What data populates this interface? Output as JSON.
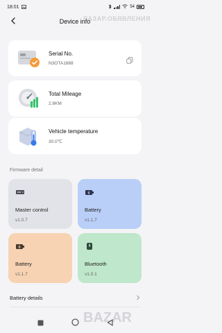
{
  "status_bar": {
    "time": "18:01",
    "battery_percent": "54"
  },
  "header": {
    "title": "Device info",
    "watermark": "ВАЗАР.ОБЯВЛЕНИЯ"
  },
  "info_cards": [
    {
      "label": "Serial No.",
      "value": "N3OTA1888",
      "icon": "scooter-serial-icon"
    },
    {
      "label": "Total Mileage",
      "value": "2.8KM",
      "icon": "speedometer-icon"
    },
    {
      "label": "Vehicle temperature",
      "value": "30.0℃",
      "icon": "thermometer-icon"
    }
  ],
  "firmware": {
    "section_title": "Firmware detail",
    "tiles": [
      {
        "name": "Master control",
        "version": "v1.0.7",
        "color": "#e2e3e8",
        "icon": "controller-icon"
      },
      {
        "name": "Battery",
        "version": "v1.1.7",
        "color": "#b9cff7",
        "icon": "battery-icon"
      },
      {
        "name": "Battery",
        "version": "v1.1.7",
        "color": "#f7d3b3",
        "icon": "battery-icon"
      },
      {
        "name": "Bluetooth",
        "version": "v1.0.1",
        "color": "#bfe7cb",
        "icon": "bluetooth-icon"
      }
    ]
  },
  "battery_details": {
    "label": "Battery details"
  },
  "logo_text": "BAZAR"
}
